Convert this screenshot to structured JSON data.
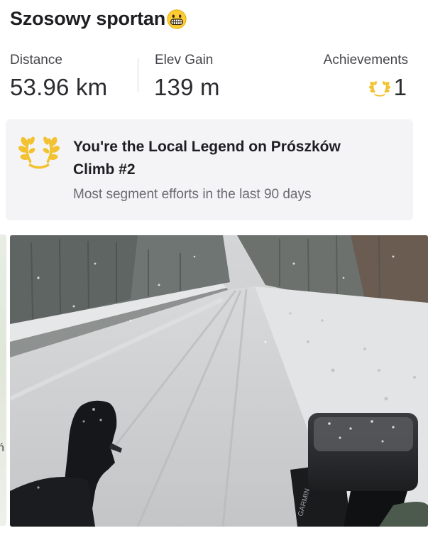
{
  "activity": {
    "title": "Szosowy sportan",
    "title_emoji": "grinning-face-emoji"
  },
  "stats": {
    "distance_label": "Distance",
    "distance_value": "53.96 km",
    "elev_label": "Elev Gain",
    "elev_value": "139 m",
    "achievements_label": "Achievements",
    "achievements_value": "1",
    "achievements_icon": "laurel-icon"
  },
  "legend": {
    "icon": "laurel-wreath-icon",
    "title": "You're the Local Legend on Prószków Climb #2",
    "subtitle": "Most segment efforts in the last 90 days"
  },
  "left_strip": {
    "visible_char": "ń"
  },
  "photo": {
    "subject": "snowy road from bicycle handlebar view",
    "device_brand": "GARMIN"
  },
  "colors": {
    "laurel_gold": "#F2C230",
    "card_bg": "#F4F4F6",
    "text_dark": "#242428",
    "text_muted": "#6A6A70"
  }
}
